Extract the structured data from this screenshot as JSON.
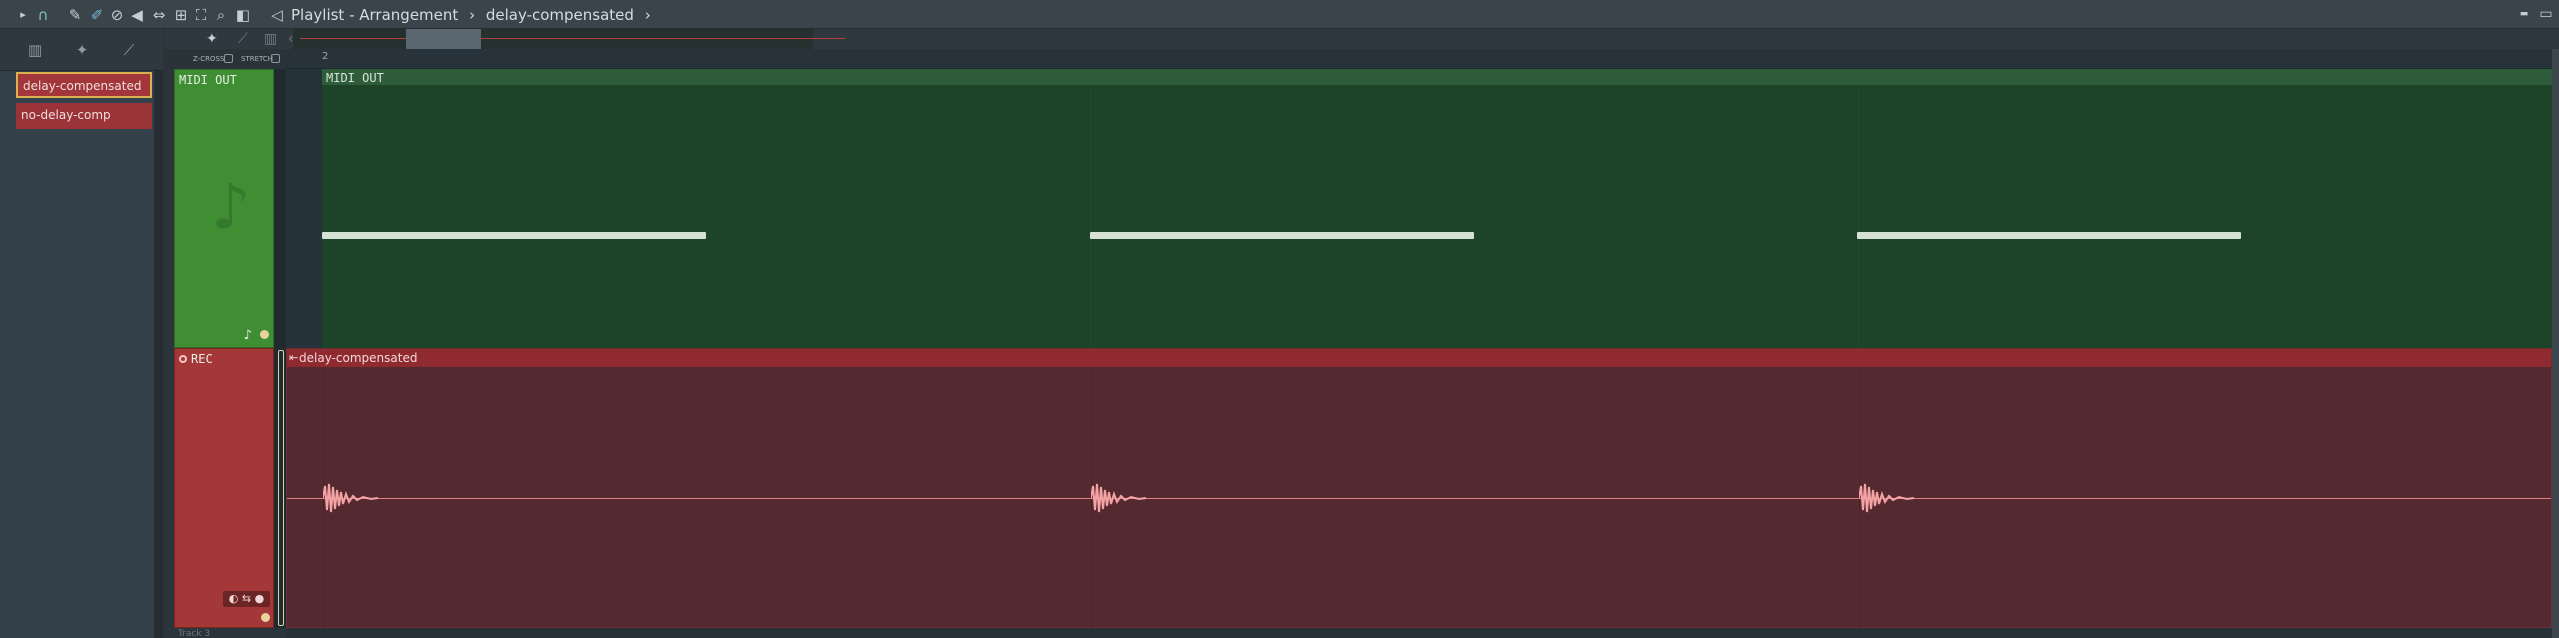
{
  "titlebar": {
    "breadcrumb": [
      "Playlist - Arrangement",
      "›",
      "delay-compensated",
      "›"
    ],
    "minimize": "▬",
    "maximize": "▭"
  },
  "patterns": [
    {
      "label": "delay-compensated",
      "selected": true
    },
    {
      "label": "no-delay-comp",
      "selected": false
    }
  ],
  "options": {
    "slide_label": "Z-CROSS",
    "stretch_label": "STRETCH"
  },
  "ruler": {
    "bar_label": "2"
  },
  "tracks": [
    {
      "label": "MIDI OUT",
      "color": "#3f8e34"
    },
    {
      "label": "REC",
      "color": "#a43737"
    }
  ],
  "clips": {
    "midi": {
      "label": "MIDI OUT"
    },
    "audio": {
      "label": "delay-compensated"
    }
  },
  "track3": {
    "label": "Track 3"
  },
  "icons": [
    "play-arrow-icon",
    "magnet-icon",
    "pencil-icon",
    "brush-icon",
    "delete-icon",
    "mute-icon",
    "slip-icon",
    "select-icon",
    "zoom-icon",
    "playback-icon",
    "note-icon",
    "rec-icon"
  ]
}
